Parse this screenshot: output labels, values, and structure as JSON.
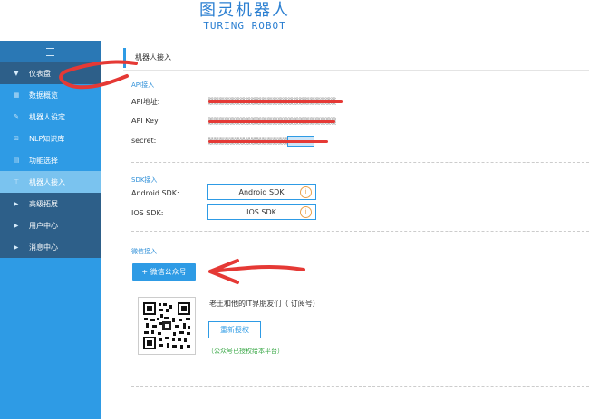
{
  "brand": {
    "logo_cn": "图灵机器人",
    "logo_en": "TURING ROBOT"
  },
  "sidebar": {
    "items": [
      {
        "label": "仪表盘",
        "icon": "caret-down-icon"
      },
      {
        "label": "数据概览",
        "icon": "chart-icon"
      },
      {
        "label": "机器人设定",
        "icon": "wrench-icon"
      },
      {
        "label": "NLP知识库",
        "icon": "cart-icon"
      },
      {
        "label": "功能选择",
        "icon": "grid-icon"
      },
      {
        "label": "机器人接入",
        "icon": "plug-icon"
      },
      {
        "label": "高级拓展",
        "icon": "caret-right-icon"
      },
      {
        "label": "用户中心",
        "icon": "caret-right-icon"
      },
      {
        "label": "消息中心",
        "icon": "caret-right-icon"
      }
    ],
    "active_item": "机器人接入"
  },
  "page": {
    "title": "机器人接入"
  },
  "api": {
    "section_title": "API接入",
    "address_label": "API地址:",
    "key_label": "API Key:",
    "secret_label": "secret:"
  },
  "sdk": {
    "section_title": "SDK接入",
    "android_label": "Android SDK:",
    "android_button": "Android SDK",
    "ios_label": "IOS SDK:",
    "ios_button": "IOS SDK",
    "info_icon": "i"
  },
  "wechat": {
    "section_title": "微信接入",
    "button_label": "+ 微信公众号",
    "account_name": "老王和他的IT界朋友们（ 订阅号）",
    "reauth_button": "重新授权",
    "authorized_note": "（公众号已授权给本平台）"
  },
  "colors": {
    "accent": "#2e9be5",
    "sidebar_dark": "#2d5f89",
    "annotation": "#e53935",
    "success": "#3aa847"
  }
}
